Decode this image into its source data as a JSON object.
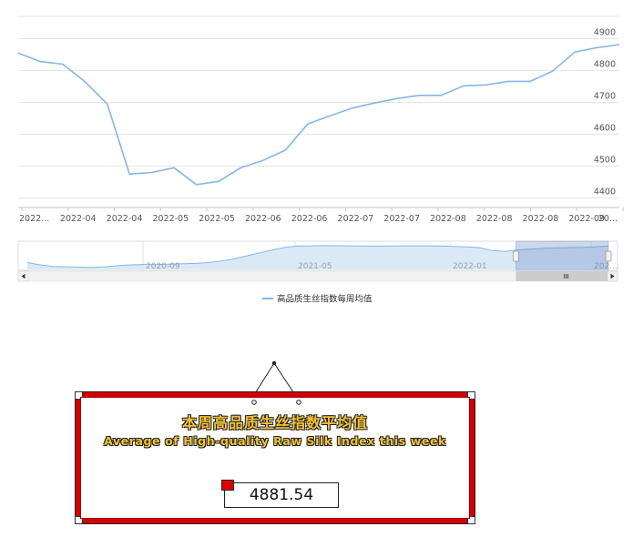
{
  "chart_data": {
    "type": "line",
    "series": [
      {
        "name": "高品质生丝指数每周均值",
        "color": "#85b6e6",
        "values": [
          4855,
          4828,
          4820,
          4765,
          4695,
          4475,
          4480,
          4495,
          4442,
          4452,
          4495,
          4518,
          4550,
          4632,
          4658,
          4682,
          4698,
          4712,
          4722,
          4722,
          4752,
          4755,
          4766,
          4766,
          4798,
          4858,
          4872,
          4881.54
        ]
      }
    ],
    "x_tick_labels": [
      "2022...",
      "2022-04",
      "2022-04",
      "2022-05",
      "2022-05",
      "2022-06",
      "2022-06",
      "2022-07",
      "2022-07",
      "2022-08",
      "2022-08",
      "2022-08",
      "2022-09",
      "20..."
    ],
    "y_ticks": [
      4400,
      4500,
      4600,
      4700,
      4800,
      4900
    ],
    "ylim": [
      4370,
      4970
    ],
    "grid": true,
    "legend_position": "bottom-center",
    "navigator": {
      "labels": [
        "2020-09",
        "2021-05",
        "2022-01",
        "202..."
      ],
      "overview_values": [
        4590,
        4560,
        4540,
        4535,
        4530,
        4528,
        4535,
        4550,
        4560,
        4565,
        4565,
        4570,
        4575,
        4580,
        4590,
        4610,
        4640,
        4680,
        4720,
        4760,
        4795,
        4810,
        4812,
        4815,
        4814,
        4812,
        4810,
        4808,
        4810,
        4812,
        4813,
        4812,
        4810,
        4805,
        4798,
        4790,
        4750,
        4740,
        4760,
        4770,
        4780,
        4785,
        4790,
        4792,
        4800,
        4810
      ],
      "selected_range_percent": [
        80,
        100
      ]
    }
  },
  "card": {
    "title_cn": "本周高品质生丝指数平均值",
    "title_en": "Average of High-quality Raw Silk Index this week",
    "value": "4881.54"
  }
}
